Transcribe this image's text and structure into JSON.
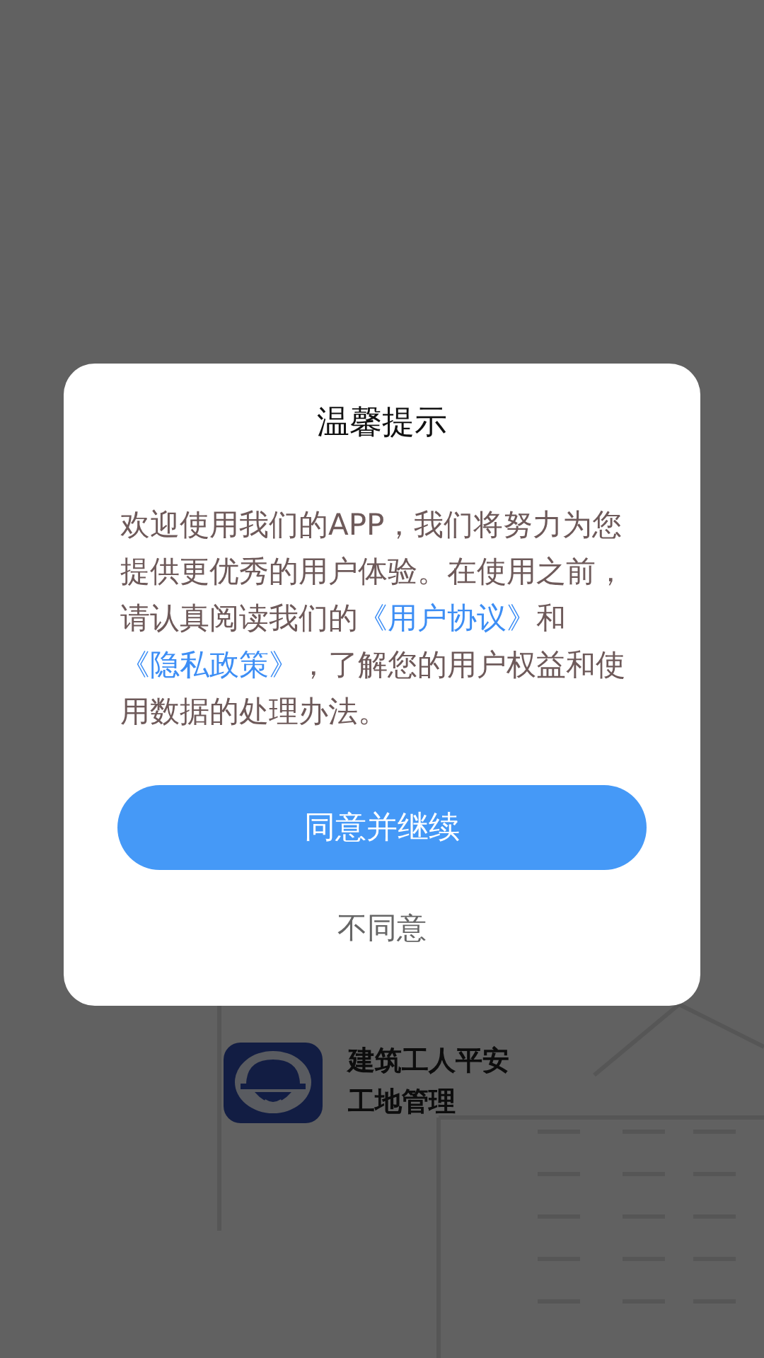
{
  "background": {
    "app_name_lines": [
      "建筑工人平安",
      "工地管理"
    ]
  },
  "dialog": {
    "title": "温馨提示",
    "message": [
      {
        "kind": "text",
        "text": "欢迎使用我们的APP，我们将努力为您提供更优秀的用户体验。在使用之前，请认真阅读我们的"
      },
      {
        "kind": "link",
        "text": "《用户协议》"
      },
      {
        "kind": "text",
        "text": "和"
      },
      {
        "kind": "link",
        "text": "《隐私政策》"
      },
      {
        "kind": "text",
        "text": "，了解您的用户权益和使用数据的处理办法。"
      }
    ],
    "buttons": [
      {
        "kind": "primary",
        "label": "同意并继续"
      },
      {
        "kind": "plain",
        "label": "不同意"
      }
    ]
  }
}
